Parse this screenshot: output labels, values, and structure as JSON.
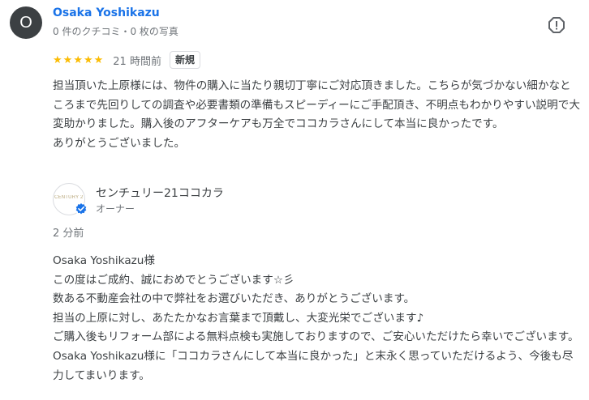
{
  "review": {
    "avatar_letter": "O",
    "reviewer_name": "Osaka Yoshikazu",
    "reviewer_meta": "0 件のクチコミ・0 枚の写真",
    "rating": 5,
    "time": "21 時間前",
    "badge": "新規",
    "text": "担当頂いた上原様には、物件の購入に当たり親切丁寧にご対応頂きました。こちらが気づかない細かなところまで先回りしての調査や必要書類の準備もスピーディーにご手配頂き、不明点もわかりやすい説明で大変助かりました。購入後のアフターケアも万全でココカラさんにして本当に良かったです。\nありがとうございました。",
    "star_color": "#fbbc04"
  },
  "owner_response": {
    "logo_text": "CENTURY 21",
    "owner_name": "センチュリー21ココカラ",
    "role": "オーナー",
    "time": "2 分前",
    "text": "Osaka Yoshikazu様\nこの度はご成約、誠におめでとうございます☆彡\n数ある不動産会社の中で弊社をお選びいただき、ありがとうございます。\n担当の上原に対し、あたたかなお言葉まで頂戴し、大変光栄でございます♪\nご購入後もリフォーム部による無料点検も実施しておりますので、ご安心いただけたら幸いでございます。\nOsaka Yoshikazu様に「ココカラさんにして本当に良かった」と末永く思っていただけるよう、今後も尽力してまいります。",
    "verified_color": "#1a73e8"
  }
}
